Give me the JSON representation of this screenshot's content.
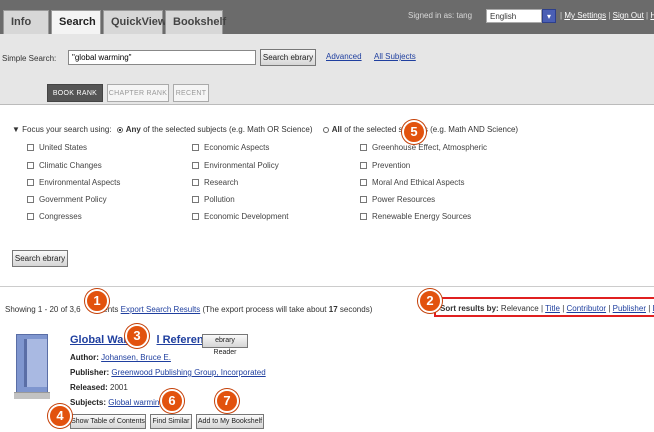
{
  "tabs": {
    "info": "Info",
    "search": "Search",
    "quickview": "QuickView",
    "bookshelf": "Bookshelf"
  },
  "header": {
    "signed_in": "Signed in as: tang",
    "language": "English",
    "language_icon": "chevron-down-icon",
    "my_settings": "My Settings",
    "sign_out": "Sign Out",
    "help": "He",
    "sep": "|"
  },
  "search": {
    "label": "Simple Search:",
    "value": "\"global warming\"",
    "button": "Search ebrary",
    "advanced": "Advanced",
    "all_subjects": "All Subjects"
  },
  "rank_tabs": {
    "book": "BOOK RANK",
    "chapter": "CHAPTER RANK",
    "recent": "RECENT"
  },
  "focus": {
    "lead": "▼ Focus your search using:",
    "any_bold": "Any",
    "any_rest": "of the selected subjects (e.g. Math OR Science)",
    "all_bold": "All",
    "all_rest": "of the selected subjects (e.g. Math AND Science)"
  },
  "subjects": {
    "col1": [
      "United States",
      "Climatic Changes",
      "Environmental Aspects",
      "Government Policy",
      "Congresses"
    ],
    "col2": [
      "Economic Aspects",
      "Environmental Policy",
      "Research",
      "Pollution",
      "Economic Development"
    ],
    "col3": [
      "Greenhouse Effect, Atmospheric",
      "Prevention",
      "Moral And Ethical Aspects",
      "Power Resources",
      "Renewable Energy Sources"
    ]
  },
  "search_button_2": "Search ebrary",
  "results": {
    "showing": "Showing 1 - 20 of 3,6",
    "documents": "ments",
    "export": "Export Search Results",
    "export_note_pre": "(The export process will take about",
    "export_note_num": "17",
    "export_note_post": "seconds)"
  },
  "sort": {
    "label": "Sort results by:",
    "relevance": "Relevance",
    "title": "Title",
    "contributor": "Contributor",
    "publisher": "Publisher",
    "date": "Da",
    "sep": "|"
  },
  "result": {
    "cover_icon": "book-icon",
    "title_start": "Global Warmi",
    "title_end": "l Reference",
    "reader_button": "ebrary Reader",
    "author_label": "Author:",
    "author": "Johansen, Bruce E.",
    "publisher_label": "Publisher:",
    "publisher": "Greenwood Publishing Group, Incorporated",
    "released_label": "Released:",
    "released": "2001",
    "subjects_label": "Subjects:",
    "subjects": "Global warming."
  },
  "actions": {
    "toc": "Show Table of Contents",
    "similar": "Find Similar",
    "bookshelf": "Add to My Bookshelf"
  },
  "callouts": [
    "1",
    "2",
    "3",
    "4",
    "5",
    "6",
    "7"
  ],
  "colors": {
    "callout": "#e2520e",
    "sort_highlight": "#e02020",
    "link": "#1f3f9f",
    "topbar": "#6b6b6b"
  }
}
